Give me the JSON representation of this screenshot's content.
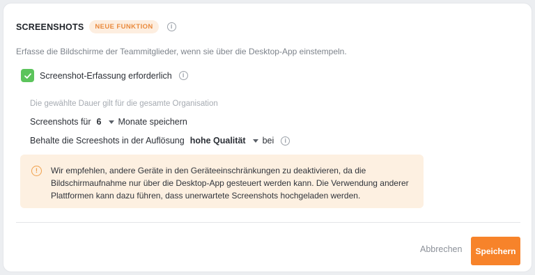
{
  "header": {
    "title": "SCREENSHOTS",
    "badge": "NEUE FUNKTION"
  },
  "description": "Erfasse die Bildschirme der Teammitglieder, wenn sie über die Desktop-App einstempeln.",
  "checkbox": {
    "label": "Screenshot-Erfassung erforderlich",
    "checked": true,
    "color": "#5cc45c"
  },
  "note": "Die gewählte Dauer gilt für die gesamte Organisation",
  "retention": {
    "prefix": "Screenshots für",
    "value": "6",
    "suffix": "Monate speichern"
  },
  "resolution": {
    "prefix": "Behalte die Screeshots in der Auflösung",
    "value": "hohe Qualität",
    "suffix": "bei"
  },
  "warning": {
    "text": "Wir empfehlen, andere Geräte in den Geräteeinschränkungen zu deaktivieren, da die Bildschirmaufnahme nur über die Desktop-App gesteuert werden kann. Die Verwendung anderer Plattformen kann dazu führen, dass unerwartete Screenshots hochgeladen werden."
  },
  "footer": {
    "cancel_label": "Abbrechen",
    "save_label": "Speichern"
  },
  "colors": {
    "accent": "#f7832a",
    "badge_bg": "#fdeee0",
    "warning_bg": "#fdf0e1"
  }
}
